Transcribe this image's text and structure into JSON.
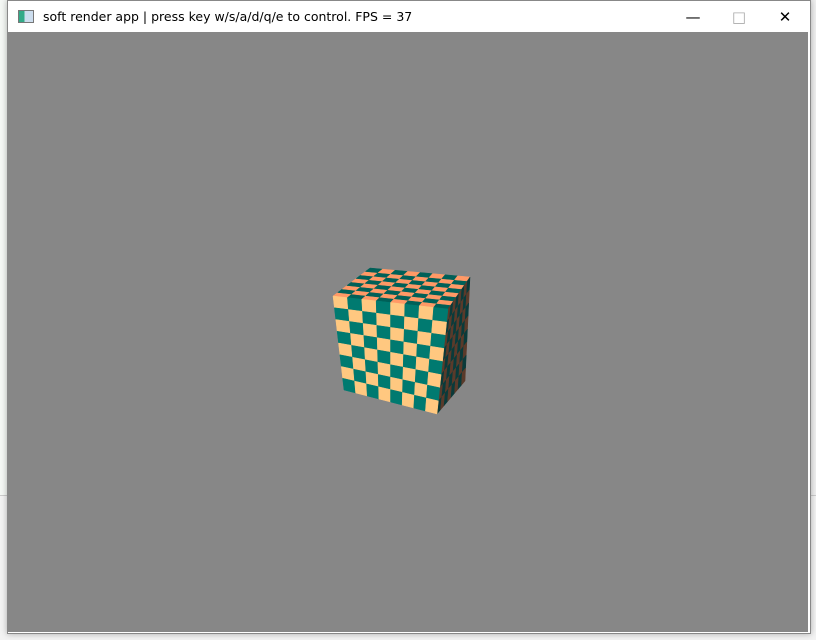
{
  "window": {
    "title": "soft render app | press key w/s/a/d/q/e to control. FPS = 37",
    "minimize_icon": "minimize-icon",
    "maximize_icon": "maximize-icon",
    "close_icon": "close-icon"
  },
  "scene": {
    "background_color": "#878787",
    "checker_colors": {
      "front_light": "#ffc880",
      "front_dark": "#007a70",
      "top_light": "#ff9966",
      "top_dark": "#006058",
      "side_light": "#5a3a2a",
      "side_dark": "#0a3a3a"
    },
    "checker_divisions": 8
  }
}
